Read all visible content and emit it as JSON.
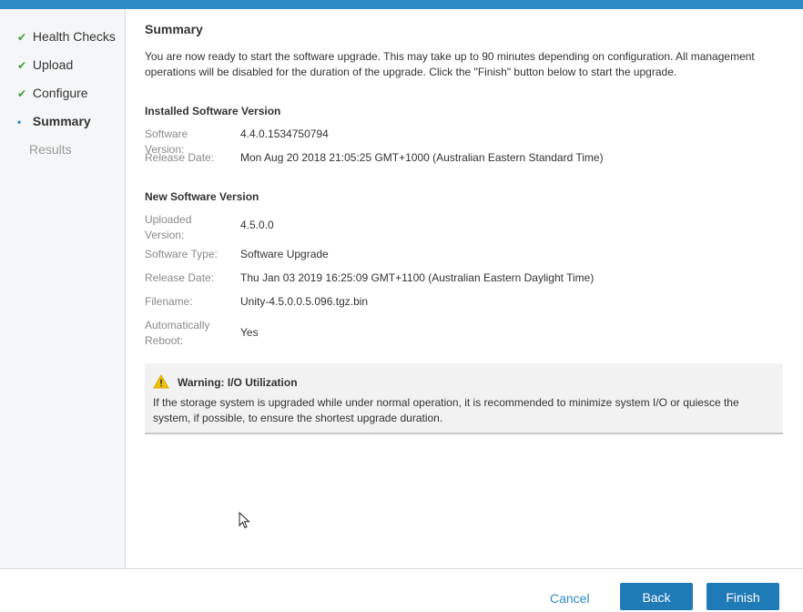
{
  "sidebar": {
    "steps": [
      {
        "label": "Health Checks",
        "state": "done"
      },
      {
        "label": "Upload",
        "state": "done"
      },
      {
        "label": "Configure",
        "state": "done"
      },
      {
        "label": "Summary",
        "state": "current"
      },
      {
        "label": "Results",
        "state": "todo"
      }
    ],
    "done_mark": "✔",
    "current_mark": "•"
  },
  "main": {
    "title": "Summary",
    "intro": "You are now ready to start the software upgrade. This may take up to 90 minutes depending on configuration. All management operations will be disabled for the duration of the upgrade. Click the \"Finish\" button below to start the upgrade.",
    "installed": {
      "heading": "Installed Software Version",
      "version_label": "Software Version:",
      "version_value": "4.4.0.1534750794",
      "release_label": "Release Date:",
      "release_value": "Mon Aug 20 2018 21:05:25 GMT+1000 (Australian Eastern Standard Time)"
    },
    "new": {
      "heading": "New Software Version",
      "uploaded_label": "Uploaded Version:",
      "uploaded_value": "4.5.0.0",
      "type_label": "Software Type:",
      "type_value": "Software Upgrade",
      "release_label": "Release Date:",
      "release_value": "Thu Jan 03 2019 16:25:09 GMT+1100 (Australian Eastern Daylight Time)",
      "filename_label": "Filename:",
      "filename_value": "Unity-4.5.0.0.5.096.tgz.bin",
      "reboot_label": "Automatically Reboot:",
      "reboot_value": "Yes"
    },
    "warning": {
      "title": "Warning: I/O Utilization",
      "text": "If the storage system is upgraded while under normal operation, it is recommended to minimize system I/O or quiesce the system, if possible, to ensure the shortest upgrade duration.",
      "icon": "warning-triangle-icon",
      "icon_color": "#f2c200"
    }
  },
  "footer": {
    "cancel_label": "Cancel",
    "back_label": "Back",
    "finish_label": "Finish"
  },
  "colors": {
    "accent": "#2e8bc6",
    "button": "#1f7ab8",
    "done_check": "#3c9a3c"
  }
}
